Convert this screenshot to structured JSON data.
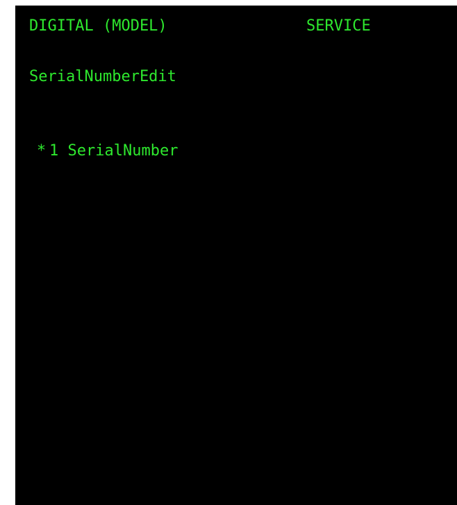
{
  "header": {
    "device_label": "DIGITAL (MODEL)",
    "mode_label": "SERVICE"
  },
  "menu": {
    "title": "SerialNumberEdit",
    "items": [
      {
        "marker": "*",
        "number": "1",
        "label": "SerialNumber"
      }
    ]
  },
  "colors": {
    "background": "#000000",
    "text": "#2ee82e"
  }
}
